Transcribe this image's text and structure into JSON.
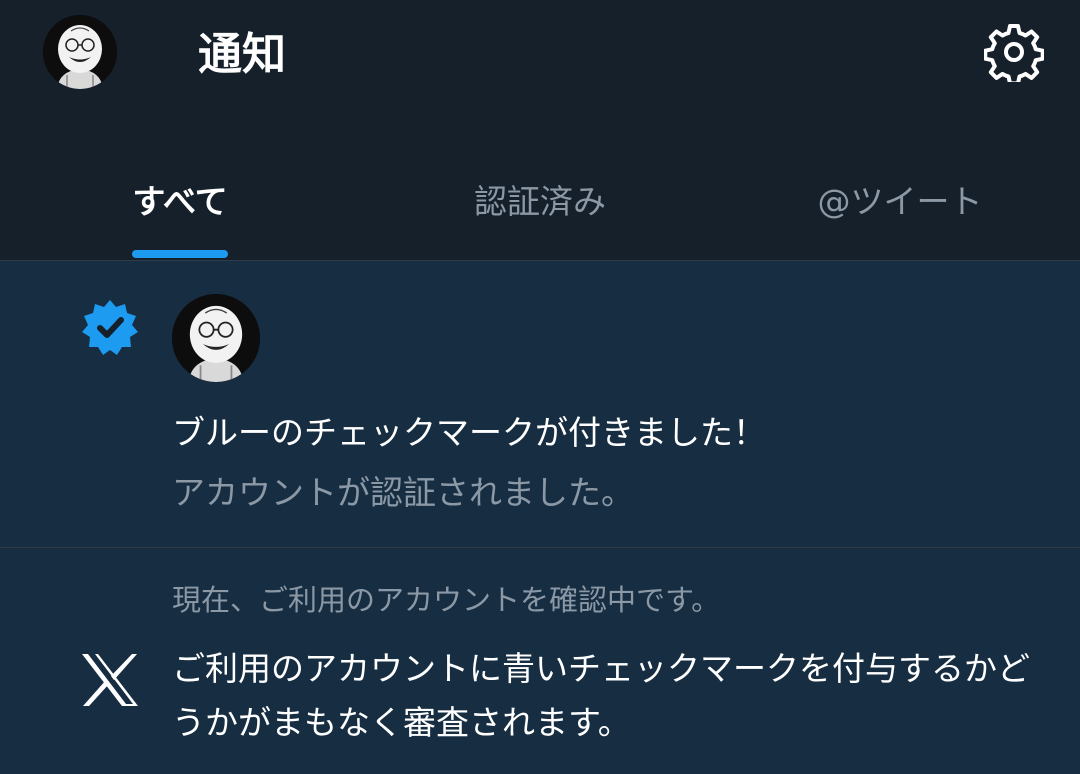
{
  "header": {
    "title": "通知",
    "avatar_icon": "user-avatar-caricature",
    "settings_icon": "gear-icon"
  },
  "tabs": [
    {
      "label": "すべて",
      "active": true
    },
    {
      "label": "認証済み",
      "active": false
    },
    {
      "label": "@ツイート",
      "active": false
    }
  ],
  "notifications": [
    {
      "icon": "verified-badge-icon",
      "title": "ブルーのチェックマークが付きました！",
      "subtitle": "アカウントが認証されました。"
    },
    {
      "icon": "x-logo-icon",
      "header": "現在、ご利用のアカウントを確認中です。",
      "body": "ご利用のアカウントに青いチェックマークを付与するかどうかがまもなく審査されます。"
    }
  ],
  "colors": {
    "background": "#15202b",
    "accent": "#1d9bf0",
    "muted_text": "#8b98a5",
    "notification_bg": "#162d42"
  }
}
